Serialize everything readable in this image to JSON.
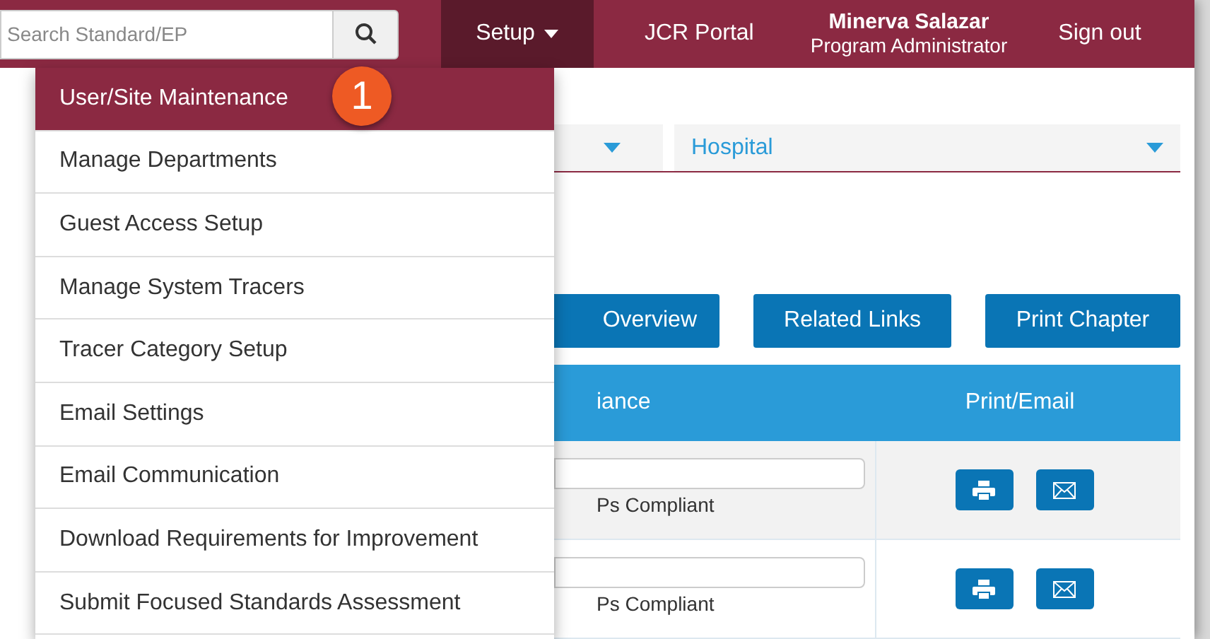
{
  "header": {
    "search": {
      "placeholder": "Search Standard/EP"
    },
    "nav": [
      {
        "label": "Setup",
        "kind": "dropdown",
        "selected": true
      },
      {
        "label": "JCR Portal",
        "kind": "link",
        "selected": false
      }
    ],
    "user": {
      "name": "Minerva Salazar",
      "role": "Program Administrator"
    },
    "sign_out": "Sign out"
  },
  "setup_menu": {
    "items": [
      {
        "label": "User/Site Maintenance",
        "selected": true
      },
      {
        "label": "Manage Departments",
        "selected": false
      },
      {
        "label": "Guest Access Setup",
        "selected": false
      },
      {
        "label": "Manage System Tracers",
        "selected": false
      },
      {
        "label": "Tracer Category Setup",
        "selected": false
      },
      {
        "label": "Email Settings",
        "selected": false
      },
      {
        "label": "Email Communication",
        "selected": false
      },
      {
        "label": "Download Requirements for Improvement",
        "selected": false
      },
      {
        "label": "Submit Focused Standards Assessment",
        "selected": false
      }
    ]
  },
  "callout": "1",
  "filter": {
    "value": "Hospital"
  },
  "buttons": [
    "Overview",
    "Related Links",
    "Print Chapter"
  ],
  "table": {
    "columns": [
      "iance",
      "Print/Email"
    ],
    "rows": [
      {
        "status": "Ps Compliant"
      },
      {
        "status": "Ps Compliant"
      }
    ]
  }
}
